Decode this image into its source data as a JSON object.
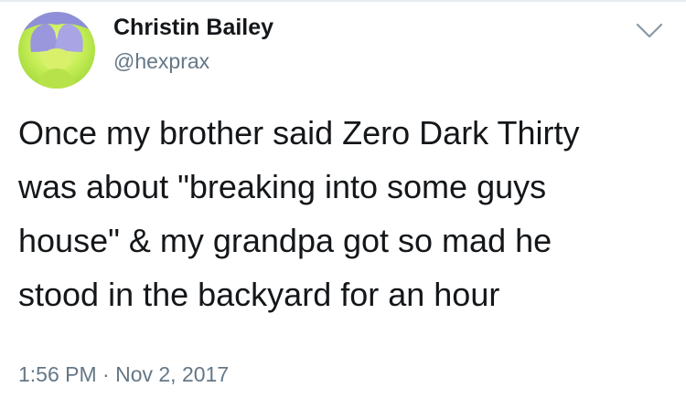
{
  "tweet": {
    "author": {
      "display_name": "Christin Bailey",
      "handle": "@hexprax"
    },
    "avatar_icon": "avatar-photo",
    "menu_icon": "chevron-down-icon",
    "text_lines": [
      "Once my brother said Zero Dark Thirty",
      "was about \"breaking into some guys",
      "house\" & my grandpa got so mad he",
      "stood in the backyard for an hour"
    ],
    "timestamp": "1:56 PM · Nov 2, 2017"
  },
  "colors": {
    "text": "#14171a",
    "secondary": "#657786",
    "divider": "#e6ecf0",
    "caret": "#8899a6"
  }
}
